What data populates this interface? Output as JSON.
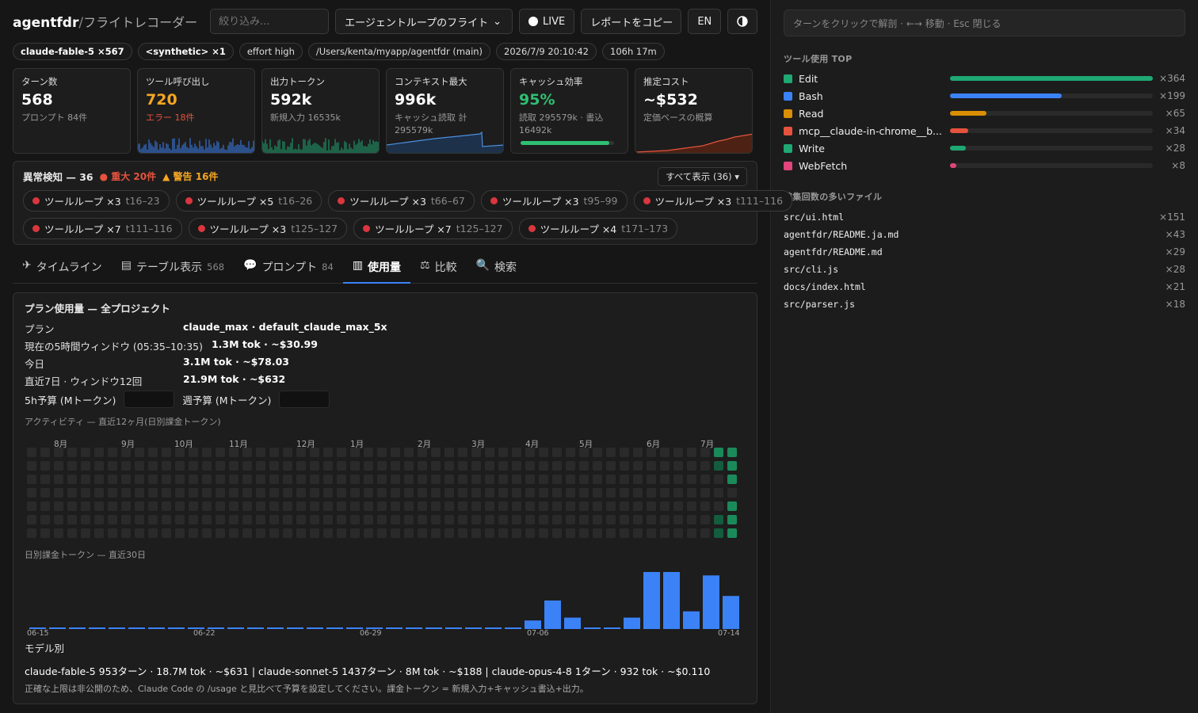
{
  "header": {
    "brand": "agentfdr",
    "sep": "/",
    "subtitle": "フライトレコーダー",
    "filter_placeholder": "絞り込み...",
    "session_select": "エージェントループのフライト",
    "live_label": "LIVE",
    "copy_report": "レポートをコピー",
    "lang": "EN"
  },
  "meta": {
    "model": "claude-fable-5 ×567",
    "synthetic": "<synthetic> ×1",
    "effort": "effort high",
    "path": "/Users/kenta/myapp/agentfdr (main)",
    "datetime": "2026/7/9 20:10:42",
    "duration": "106h 17m"
  },
  "cards": {
    "turns": {
      "label": "ターン数",
      "value": "568",
      "sub": "プロンプト 84件"
    },
    "tools": {
      "label": "ツール呼び出し",
      "value": "720",
      "sub": "エラー 18件"
    },
    "output": {
      "label": "出力トークン",
      "value": "592k",
      "sub": "新規入力 16535k"
    },
    "context": {
      "label": "コンテキスト最大",
      "value": "996k",
      "sub": "キャッシュ読取 計 295579k"
    },
    "cache": {
      "label": "キャッシュ効率",
      "value": "95%",
      "sub": "読取 295579k · 書込 16492k",
      "fill": 0.95
    },
    "cost": {
      "label": "推定コスト",
      "value": "~$532",
      "sub": "定価ベースの概算"
    }
  },
  "anomaly": {
    "title": "異常検知 — 36",
    "severe": "● 重大 20件",
    "warning": "▲ 警告 16件",
    "show_all": "すべて表示 (36) ▾",
    "items": [
      {
        "label": "ツールループ ×3",
        "range": "t16–23"
      },
      {
        "label": "ツールループ ×5",
        "range": "t16–26"
      },
      {
        "label": "ツールループ ×3",
        "range": "t66–67"
      },
      {
        "label": "ツールループ ×3",
        "range": "t95–99"
      },
      {
        "label": "ツールループ ×3",
        "range": "t111–116"
      },
      {
        "label": "ツールループ ×7",
        "range": "t111–116"
      },
      {
        "label": "ツールループ ×3",
        "range": "t125–127"
      },
      {
        "label": "ツールループ ×7",
        "range": "t125–127"
      },
      {
        "label": "ツールループ ×4",
        "range": "t171–173"
      }
    ]
  },
  "tabs": [
    {
      "label": "タイムライン",
      "icon": "✈",
      "count": ""
    },
    {
      "label": "テーブル表示",
      "icon": "▤",
      "count": "568"
    },
    {
      "label": "プロンプト",
      "icon": "💬",
      "count": "84"
    },
    {
      "label": "使用量",
      "icon": "▥",
      "count": ""
    },
    {
      "label": "比較",
      "icon": "⚖",
      "count": ""
    },
    {
      "label": "検索",
      "icon": "🔍",
      "count": ""
    }
  ],
  "usage": {
    "title": "プラン使用量 — 全プロジェクト",
    "plan_k": "プラン",
    "plan_v": "claude_max · default_claude_max_5x",
    "window_k": "現在の5時間ウィンドウ (05:35–10:35)",
    "window_v": "1.3M tok · ~$30.99",
    "today_k": "今日",
    "today_v": "3.1M tok · ~$78.03",
    "week_k": "直近7日 · ウィンドウ12回",
    "week_v": "21.9M tok · ~$632",
    "budget5h": "5h予算 (Mトークン)",
    "budgetweek": "週予算 (Mトークン)",
    "activity_title": "アクティビティ — 直近12ヶ月(日別課金トークン)",
    "months": [
      "8月",
      "9月",
      "10月",
      "11月",
      "12月",
      "1月",
      "2月",
      "3月",
      "4月",
      "5月",
      "6月",
      "7月"
    ],
    "daily_title": "日別課金トークン — 直近30日",
    "xticks": [
      "06-15",
      "06-22",
      "06-29",
      "07-06",
      "07-14"
    ],
    "model_title": "モデル別",
    "model_line": "claude-fable-5 953ターン · 18.7M tok · ~$631 | claude-sonnet-5 1437ターン · 8M tok · ~$188 | claude-opus-4-8 1ターン · 932 tok · ~$0.110",
    "note": "正確な上限は非公開のため、Claude Code の /usage と見比べて予算を設定してください。課金トークン = 新規入力+キャッシュ書込+出力。"
  },
  "chart_data": {
    "type": "bar",
    "title": "日別課金トークン — 直近30日",
    "x_labels_shown": [
      "06-15",
      "06-22",
      "06-29",
      "07-06",
      "07-14"
    ],
    "values_relative": [
      0.01,
      0.01,
      0.01,
      0.01,
      0.01,
      0.01,
      0.01,
      0.01,
      0.01,
      0.01,
      0.01,
      0.01,
      0.01,
      0.01,
      0.01,
      0.01,
      0.01,
      0.01,
      0.01,
      0.01,
      0.01,
      0.01,
      0.01,
      0.01,
      0.01,
      0.15,
      0.5,
      0.2,
      0.01,
      0.01,
      0.2,
      1.0,
      1.0,
      0.31,
      0.94,
      0.58
    ],
    "color": "#3b82f6"
  },
  "side": {
    "hint": "ターンをクリックで解剖 · ←→ 移動 · Esc 閉じる",
    "tools_title": "ツール使用 TOP",
    "tools": [
      {
        "name": "Edit",
        "count": "×364",
        "color": "#1fa873",
        "fill": 1.0
      },
      {
        "name": "Bash",
        "count": "×199",
        "color": "#3b82f6",
        "fill": 0.55
      },
      {
        "name": "Read",
        "count": "×65",
        "color": "#d98e04",
        "fill": 0.18
      },
      {
        "name": "mcp__claude-in-chrome__b...",
        "count": "×34",
        "color": "#e5533d",
        "fill": 0.09
      },
      {
        "name": "Write",
        "count": "×28",
        "color": "#1fa873",
        "fill": 0.08
      },
      {
        "name": "WebFetch",
        "count": "×8",
        "color": "#e0457b",
        "fill": 0.03
      }
    ],
    "files_title": "編集回数の多いファイル",
    "files": [
      {
        "name": "src/ui.html",
        "count": "×151"
      },
      {
        "name": "agentfdr/README.ja.md",
        "count": "×43"
      },
      {
        "name": "agentfdr/README.md",
        "count": "×29"
      },
      {
        "name": "src/cli.js",
        "count": "×28"
      },
      {
        "name": "docs/index.html",
        "count": "×21"
      },
      {
        "name": "src/parser.js",
        "count": "×18"
      }
    ]
  }
}
